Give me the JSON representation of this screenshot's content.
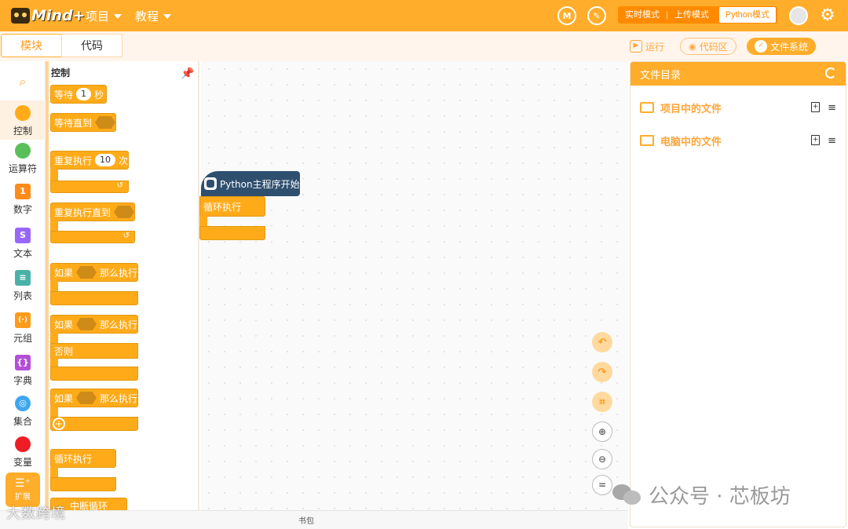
{
  "app": {
    "logo_text": "Mind+"
  },
  "topbar": {
    "menus": [
      "项目",
      "教程"
    ],
    "icon1": "M",
    "icon2": "✎",
    "modes": {
      "realtime": "实时模式",
      "separator": "|",
      "upload": "上传模式",
      "python": "Python模式"
    }
  },
  "subbar": {
    "tabs": {
      "blocks": "模块",
      "code": "代码"
    },
    "run_label": "运行",
    "code_area_label": "代码区",
    "file_system_label": "文件系统"
  },
  "categories": [
    {
      "label": "控制",
      "color": "#ffab19"
    },
    {
      "label": "运算符",
      "color": "#59c059"
    },
    {
      "label": "数字",
      "color": "#ff8c1a",
      "glyph": "1"
    },
    {
      "label": "文本",
      "color": "#9966ff",
      "glyph": "S"
    },
    {
      "label": "列表",
      "color": "#4ab1a8",
      "glyph": "≡"
    },
    {
      "label": "元组",
      "color": "#ff9b1a",
      "glyph": "(·)"
    },
    {
      "label": "字典",
      "color": "#b44fd9",
      "glyph": "{}"
    },
    {
      "label": "集合",
      "color": "#3fa6f0",
      "glyph": "◎"
    },
    {
      "label": "变量",
      "color": "#ee1c24"
    }
  ],
  "ext_label": "扩展",
  "palette": {
    "title": "控制",
    "wait": {
      "label": "等待",
      "value": "1",
      "unit": "秒"
    },
    "wait_until": "等待直到",
    "repeat": {
      "label": "重复执行",
      "value": "10",
      "unit": "次"
    },
    "repeat_until": "重复执行直到",
    "if_then": {
      "if": "如果",
      "then": "那么执行"
    },
    "else": "否则",
    "forever": "循环执行",
    "stop": "中断循环"
  },
  "canvas": {
    "hat_label": "Python主程序开始",
    "loop_label": "循环执行"
  },
  "bottom": {
    "bag_label": "书包",
    "watermark_left": "大数跨境"
  },
  "files": {
    "header": "文件目录",
    "project_files": "项目中的文件",
    "computer_files": "电脑中的文件"
  },
  "watermark_right": "公众号 · 芯板坊"
}
